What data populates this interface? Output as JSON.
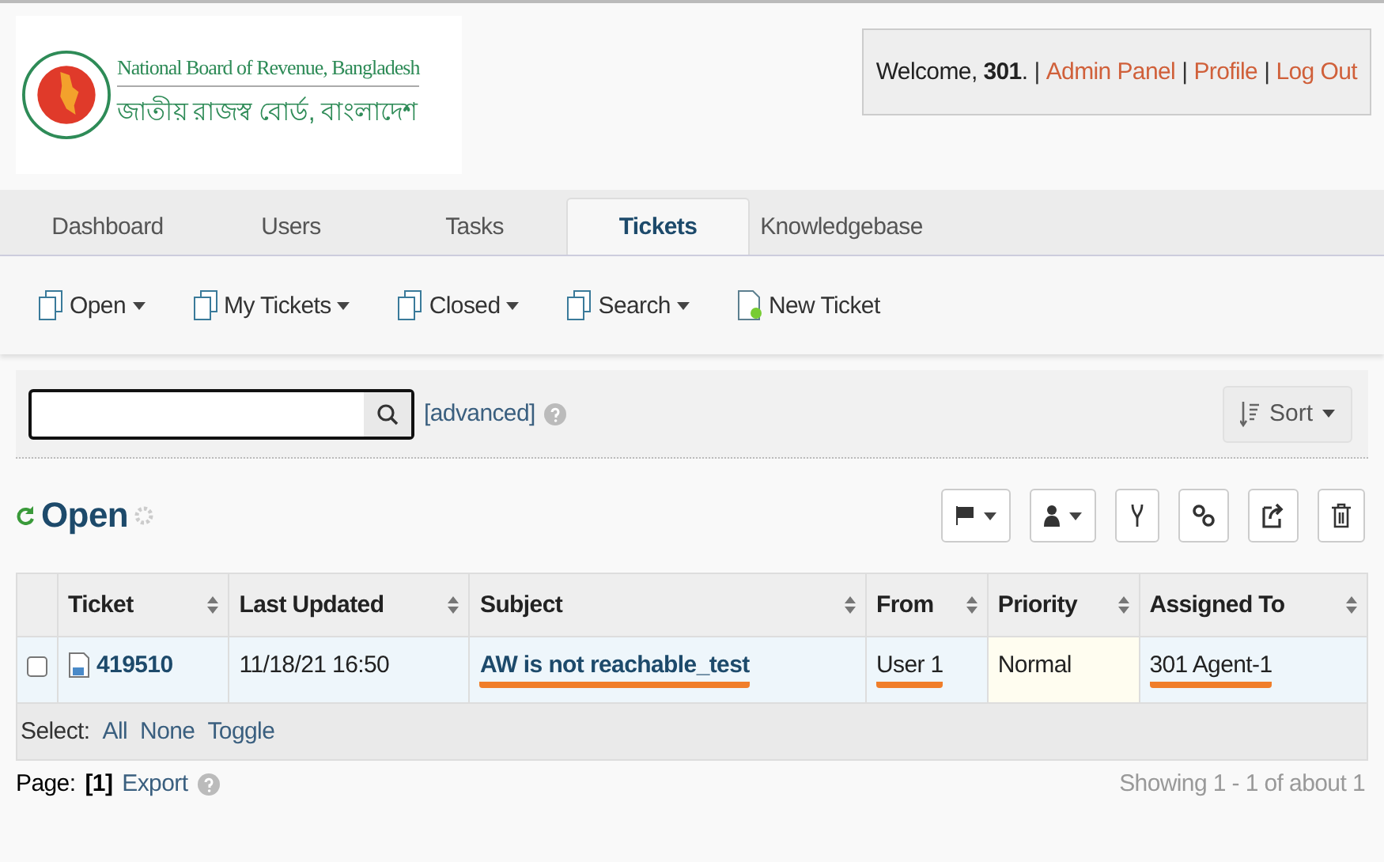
{
  "logo": {
    "title_en": "National Board of Revenue, Bangladesh",
    "title_bn": "জাতীয় রাজস্ব বোর্ড, বাংলাদেশ"
  },
  "user_bar": {
    "greeting": "Welcome, **301**.",
    "separator": "|",
    "links": [
      "Admin Panel",
      "Profile",
      "Log Out"
    ]
  },
  "tabs": [
    {
      "label": "Dashboard",
      "selected": false
    },
    {
      "label": "Users",
      "selected": false
    },
    {
      "label": "Tasks",
      "selected": false
    },
    {
      "label": "Tickets",
      "selected": true
    },
    {
      "label": "Knowledgebase",
      "selected": false
    }
  ],
  "sub_nav": [
    {
      "label": "Open",
      "kind": "dropdown"
    },
    {
      "label": "My Tickets",
      "kind": "dropdown"
    },
    {
      "label": "Closed",
      "kind": "dropdown"
    },
    {
      "label": "Search",
      "kind": "dropdown"
    },
    {
      "label": "New Ticket",
      "kind": "new"
    }
  ],
  "search": {
    "advanced": "[advanced]",
    "sort": "Sort"
  },
  "queue": {
    "title": "Open"
  },
  "table": {
    "columns": [
      "Ticket",
      "Last Updated",
      "Subject",
      "From",
      "Priority",
      "Assigned To"
    ],
    "rows": [
      {
        "checked": false,
        "cells": [
          {
            "text": "419510",
            "underlined": false
          },
          {
            "text": "11/18/21 16:50",
            "underlined": false
          },
          {
            "text": "AW is not reachable_test",
            "underlined": true
          },
          {
            "text": "User 1",
            "underlined": true
          },
          {
            "text": "Normal",
            "underlined": false
          },
          {
            "text": "301 Agent-1",
            "underlined": true
          }
        ]
      }
    ],
    "select_label": "Select:",
    "select_links": [
      "All",
      "None",
      "Toggle"
    ]
  },
  "footer": {
    "page_label": "Page:",
    "page": "[1]",
    "export": "Export",
    "showing": "Showing 1 - 1 of about 1"
  }
}
